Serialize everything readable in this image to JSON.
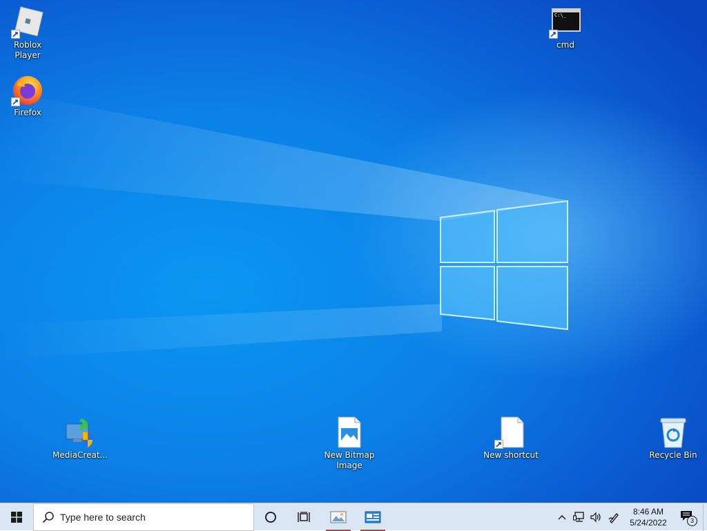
{
  "desktop": {
    "icons": {
      "roblox": {
        "label": "Roblox Player"
      },
      "firefox": {
        "label": "Firefox"
      },
      "cmd": {
        "label": "cmd",
        "screen_text": "C:\\_"
      },
      "media_creation": {
        "label": "MediaCreat..."
      },
      "bitmap": {
        "label": "New Bitmap Image"
      },
      "shortcut": {
        "label": "New shortcut"
      },
      "recycle": {
        "label": "Recycle Bin"
      }
    }
  },
  "taskbar": {
    "search": {
      "placeholder": "Type here to search"
    },
    "clock": {
      "time": "8:46 AM",
      "date": "5/24/2022"
    },
    "notifications": {
      "count": "3"
    }
  }
}
